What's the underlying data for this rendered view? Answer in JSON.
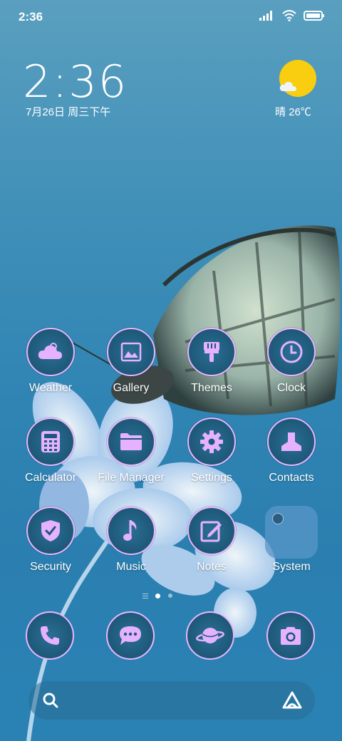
{
  "status_bar": {
    "time": "2:36",
    "icons": [
      "signal-icon",
      "wifi-icon",
      "battery-icon"
    ]
  },
  "clock_widget": {
    "time": "2:36",
    "date": "7月26日 周三下午"
  },
  "weather_widget": {
    "condition_icon": "sun-cloud-icon",
    "text": "晴 26℃",
    "sun_color": "#f9cd10"
  },
  "apps": [
    {
      "label": "Weather",
      "icon": "weather-icon"
    },
    {
      "label": "Gallery",
      "icon": "gallery-icon"
    },
    {
      "label": "Themes",
      "icon": "themes-brush-icon"
    },
    {
      "label": "Clock",
      "icon": "clock-icon"
    },
    {
      "label": "Calculator",
      "icon": "calculator-icon"
    },
    {
      "label": "File Manager",
      "icon": "folder-icon"
    },
    {
      "label": "Settings",
      "icon": "gear-icon"
    },
    {
      "label": "Contacts",
      "icon": "contact-icon"
    },
    {
      "label": "Security",
      "icon": "shield-icon"
    },
    {
      "label": "Music",
      "icon": "music-note-icon"
    },
    {
      "label": "Notes",
      "icon": "notes-icon"
    },
    {
      "label": "System",
      "icon": "folder-group-icon"
    }
  ],
  "pager": {
    "pages": 2,
    "current": 1
  },
  "dock": [
    {
      "icon": "phone-icon"
    },
    {
      "icon": "message-icon"
    },
    {
      "icon": "browser-planet-icon"
    },
    {
      "icon": "camera-icon"
    }
  ],
  "search_bar": {
    "placeholder": "",
    "left_icon": "search-icon",
    "right_icon": "assistant-icon"
  },
  "colors": {
    "icon_ring": "#e9b6ff",
    "icon_glyph": "#e6b2ff",
    "background": "#2f84b3"
  }
}
